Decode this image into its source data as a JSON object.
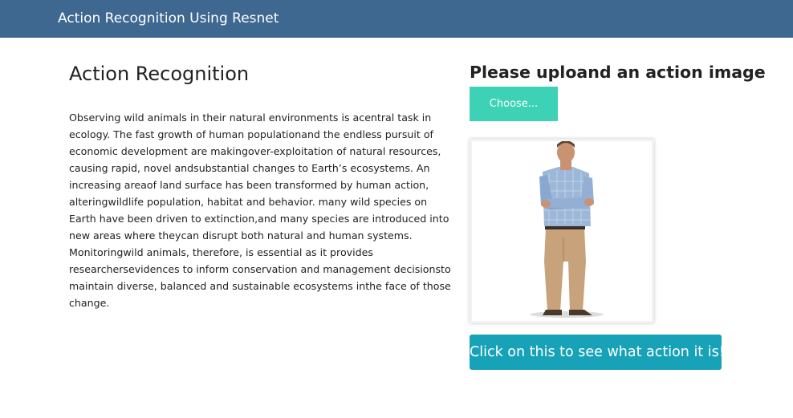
{
  "navbar": {
    "brand": "Action Recognition Using Resnet"
  },
  "main": {
    "title": "Action Recognition",
    "description": "Observing wild animals in their natural environments is acentral task in ecology. The fast growth of human populationand the endless pursuit of economic development are makingover-exploitation of natural resources, causing rapid, novel andsubstantial changes to Earth’s ecosystems. An increasing areaof land surface has been transformed by human action, alteringwildlife population, habitat and behavior. many wild species on Earth have been driven to extinction,and many species are introduced into new areas where theycan disrupt both natural and human systems. Monitoringwild animals, therefore, is essential as it provides researchersevidences to inform conservation and management decisionsto maintain diverse, balanced and sustainable ecosystems inthe face of those change."
  },
  "upload": {
    "title": "Please uploand an action image",
    "choose_label": "Choose...",
    "preview_image": "standing-man-photo",
    "predict_label": "Click on this to see what action it is!"
  },
  "colors": {
    "navbar": "#3f6891",
    "choose_button": "#3dd2b5",
    "predict_button": "#17a2b8"
  }
}
